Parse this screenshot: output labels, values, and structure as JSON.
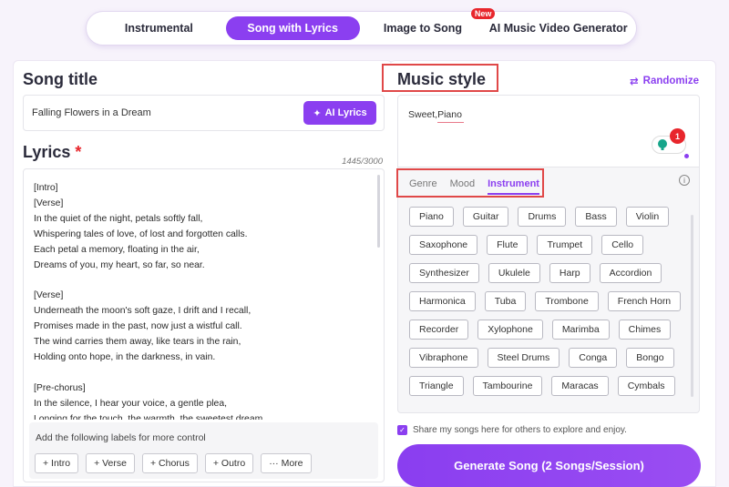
{
  "tabs": [
    {
      "label": "Instrumental"
    },
    {
      "label": "Song with Lyrics"
    },
    {
      "label": "Image to Song",
      "badge": "New"
    },
    {
      "label": "AI Music Video Generator"
    }
  ],
  "left": {
    "song_title_heading": "Song title",
    "song_title_value": "Falling Flowers in a Dream",
    "ai_lyrics_label": "AI Lyrics",
    "lyrics_heading": "Lyrics",
    "required_mark": "*",
    "counter": "1445/3000",
    "lyrics": "[Intro]\n[Verse]\nIn the quiet of the night, petals softly fall,\nWhispering tales of love, of lost and forgotten calls.\nEach petal a memory, floating in the air,\nDreams of you, my heart, so far, so near.\n\n[Verse]\nUnderneath the moon's soft gaze, I drift and I recall,\nPromises made in the past, now just a wistful call.\nThe wind carries them away, like tears in the rain,\nHolding onto hope, in the darkness, in vain.\n\n[Pre-chorus]\nIn the silence, I hear your voice, a gentle plea,\nLonging for the touch, the warmth, the sweetest dream",
    "labels_hint": "Add the following labels for more control",
    "label_buttons": [
      "+ Intro",
      "+ Verse",
      "+ Chorus",
      "+ Outro",
      "··· More"
    ]
  },
  "right": {
    "music_style_heading": "Music style",
    "randomize_label": "Randomize",
    "style_value": "Sweet,Piano",
    "grammar_count": "1",
    "subtabs": [
      "Genre",
      "Mood",
      "Instrument"
    ],
    "active_subtab": "Instrument",
    "instrument_rows": [
      [
        "Piano",
        "Guitar",
        "Drums",
        "Bass",
        "Violin"
      ],
      [
        "Saxophone",
        "Flute",
        "Trumpet",
        "Cello"
      ],
      [
        "Synthesizer",
        "Ukulele",
        "Harp",
        "Accordion"
      ],
      [
        "Harmonica",
        "Tuba",
        "Trombone",
        "French Horn"
      ],
      [
        "Recorder",
        "Xylophone",
        "Marimba",
        "Chimes"
      ],
      [
        "Vibraphone",
        "Steel Drums",
        "Conga",
        "Bongo"
      ],
      [
        "Triangle",
        "Tambourine",
        "Maracas",
        "Cymbals"
      ]
    ],
    "share_text": "Share my songs here for others to explore and enjoy.",
    "generate_label": "Generate Song (2 Songs/Session)"
  },
  "colors": {
    "accent": "#8b3ff0",
    "highlight_frame": "#e04848"
  }
}
